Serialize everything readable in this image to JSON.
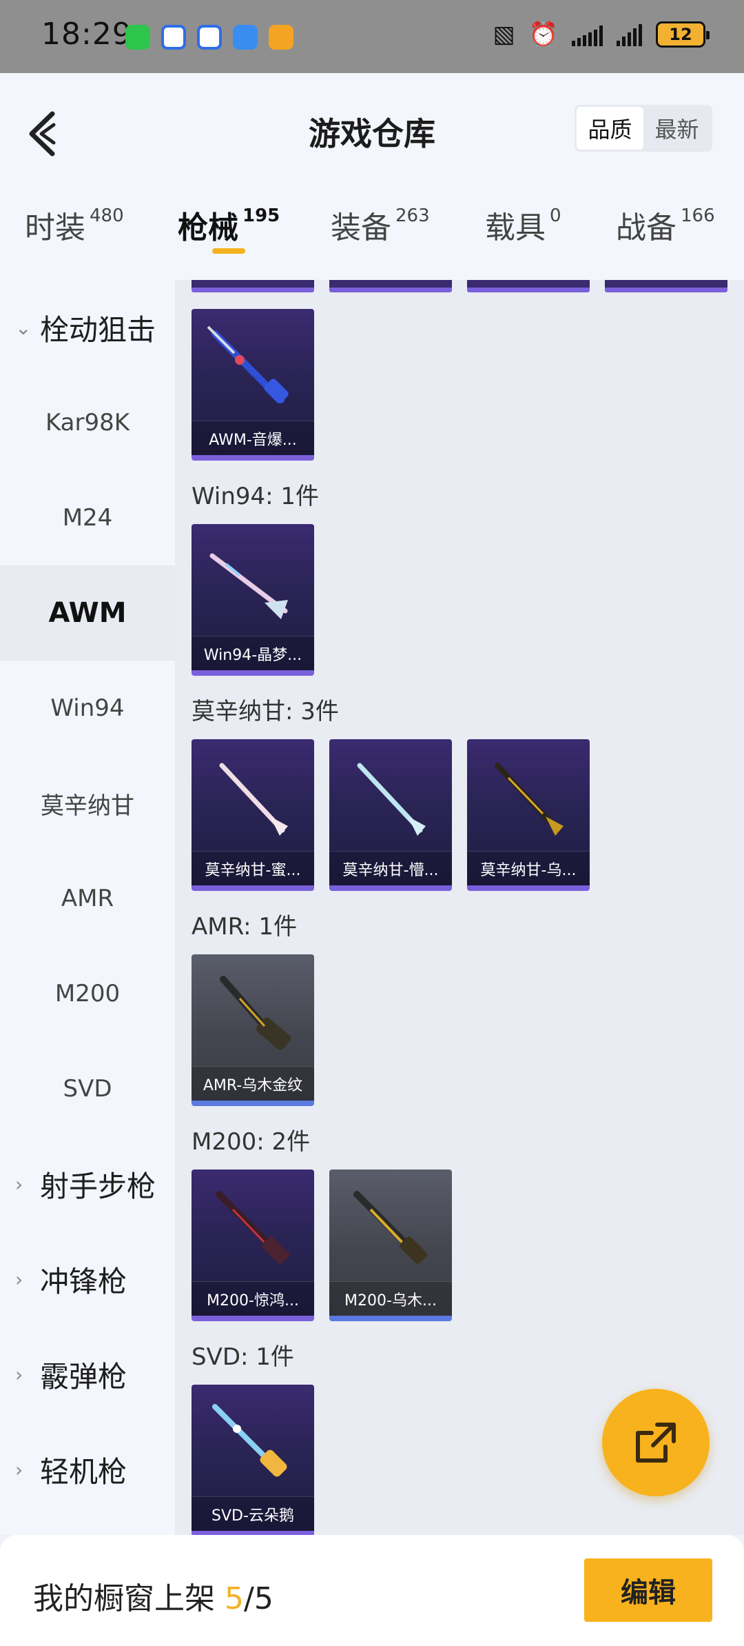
{
  "status_bar": {
    "time": "18:29",
    "battery": "12",
    "icons": [
      "wechat-icon",
      "app-icon-1",
      "app-icon-2",
      "weather-icon",
      "play-icon",
      "nfc-icon",
      "alarm-icon",
      "signal-icon",
      "signal-icon"
    ]
  },
  "header": {
    "title": "游戏仓库",
    "sort_quality": "品质",
    "sort_latest": "最新"
  },
  "tabs": [
    {
      "label": "时装",
      "count": "480"
    },
    {
      "label": "枪械",
      "count": "195"
    },
    {
      "label": "装备",
      "count": "263"
    },
    {
      "label": "载具",
      "count": "0"
    },
    {
      "label": "战备",
      "count": "166"
    }
  ],
  "sidebar": {
    "group_label": "栓动狙击",
    "items": [
      "Kar98K",
      "M24",
      "AWM",
      "Win94",
      "莫辛纳甘",
      "AMR",
      "M200",
      "SVD"
    ],
    "active_item": "AWM",
    "other_groups": [
      "射手步枪",
      "冲锋枪",
      "霰弹枪",
      "轻机枪"
    ]
  },
  "sections": {
    "awm_items": [
      "AWM-音爆..."
    ],
    "win94_title": "Win94: 1件",
    "win94_items": [
      "Win94-晶梦..."
    ],
    "mosin_title": "莫辛纳甘: 3件",
    "mosin_items": [
      "莫辛纳甘-蜜...",
      "莫辛纳甘-懵...",
      "莫辛纳甘-乌..."
    ],
    "amr_title": "AMR: 1件",
    "amr_items": [
      "AMR-乌木金纹"
    ],
    "m200_title": "M200: 2件",
    "m200_items": [
      "M200-惊鸿...",
      "M200-乌木..."
    ],
    "svd_title": "SVD: 1件",
    "svd_items": [
      "SVD-云朵鹅"
    ]
  },
  "bottom_bar": {
    "shelf_prefix": "我的橱窗上架 ",
    "shelf_current": "5",
    "shelf_total": "/5",
    "edit_label": "编辑"
  },
  "colors": {
    "accent": "#f8b21d",
    "card_purple": "#2a2455",
    "card_purple_edge": "#7b60dc",
    "card_grey": "#44464f",
    "card_grey_edge": "#5b79e0"
  }
}
